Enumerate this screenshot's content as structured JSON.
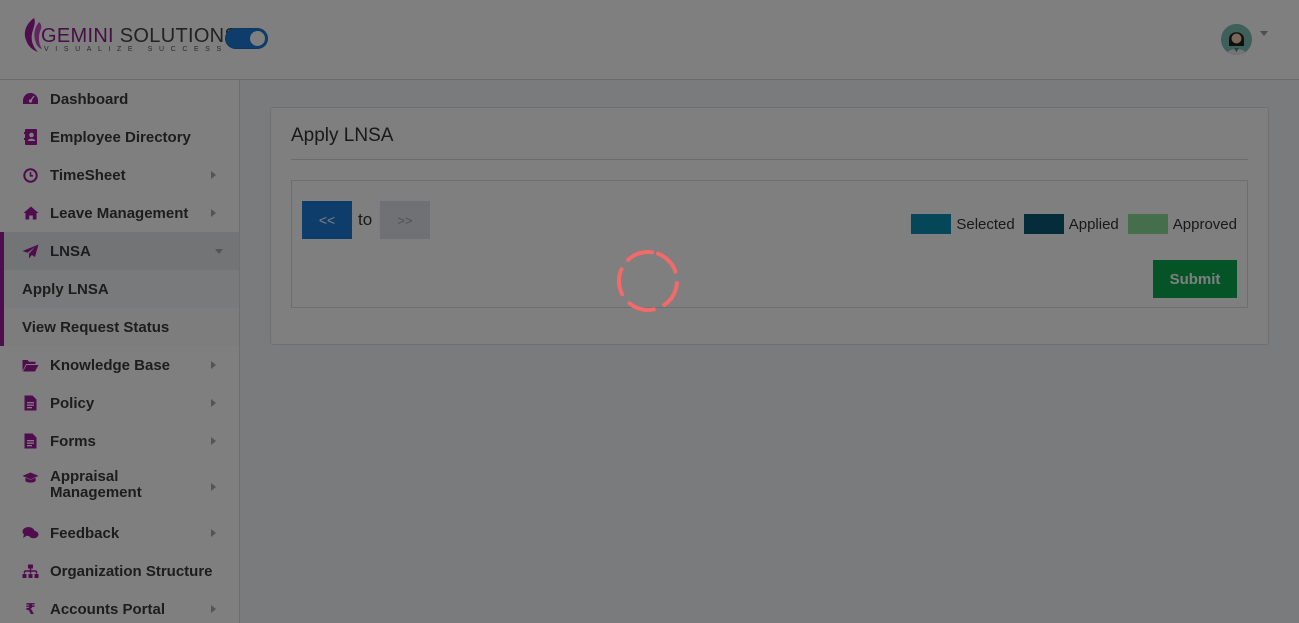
{
  "header": {
    "brand_primary": "GEMINI",
    "brand_secondary": "SOLUTIONS",
    "tagline": "VISUALIZE SUCCESS",
    "theme_toggle_on": true,
    "avatar_icon": "user-avatar-icon",
    "accent_color": "#a01a9c",
    "toggle_color": "#1f7ad6"
  },
  "sidebar": {
    "items": [
      {
        "label": "Dashboard",
        "icon": "dashboard-icon",
        "has_caret": false
      },
      {
        "label": "Employee Directory",
        "icon": "contact-book-icon",
        "has_caret": false
      },
      {
        "label": "TimeSheet",
        "icon": "clock-icon",
        "has_caret": true
      },
      {
        "label": "Leave Management",
        "icon": "home-icon",
        "has_caret": true
      },
      {
        "label": "LNSA",
        "icon": "paper-plane-icon",
        "has_caret": true,
        "expanded": true
      },
      {
        "label": "Knowledge Base",
        "icon": "folder-open-icon",
        "has_caret": true
      },
      {
        "label": "Policy",
        "icon": "document-icon",
        "has_caret": true
      },
      {
        "label": "Forms",
        "icon": "form-document-icon",
        "has_caret": true
      },
      {
        "label": "Appraisal Management",
        "icon": "graduation-cap-icon",
        "has_caret": true
      },
      {
        "label": "Feedback",
        "icon": "chat-bubbles-icon",
        "has_caret": true
      },
      {
        "label": "Organization Structure",
        "icon": "sitemap-icon",
        "has_caret": false
      },
      {
        "label": "Accounts Portal",
        "icon": "rupee-icon",
        "has_caret": true
      }
    ],
    "lnsa_subitems": [
      {
        "label": "Apply LNSA",
        "selected": true
      },
      {
        "label": "View Request Status",
        "selected": false
      }
    ]
  },
  "main": {
    "card_title": "Apply LNSA",
    "nav": {
      "prev_label": "<<",
      "to_label": "to",
      "next_label": ">>"
    },
    "legend": [
      {
        "label": "Selected",
        "color": "#0a8cb3"
      },
      {
        "label": "Applied",
        "color": "#0a5872"
      },
      {
        "label": "Approved",
        "color": "#8bdc9b"
      }
    ],
    "submit_label": "Submit",
    "submit_color": "#0aa84f"
  },
  "overlay": {
    "loading": true,
    "spinner_color": "#f26a6a",
    "spinner_icon": "loading-spinner-icon"
  }
}
